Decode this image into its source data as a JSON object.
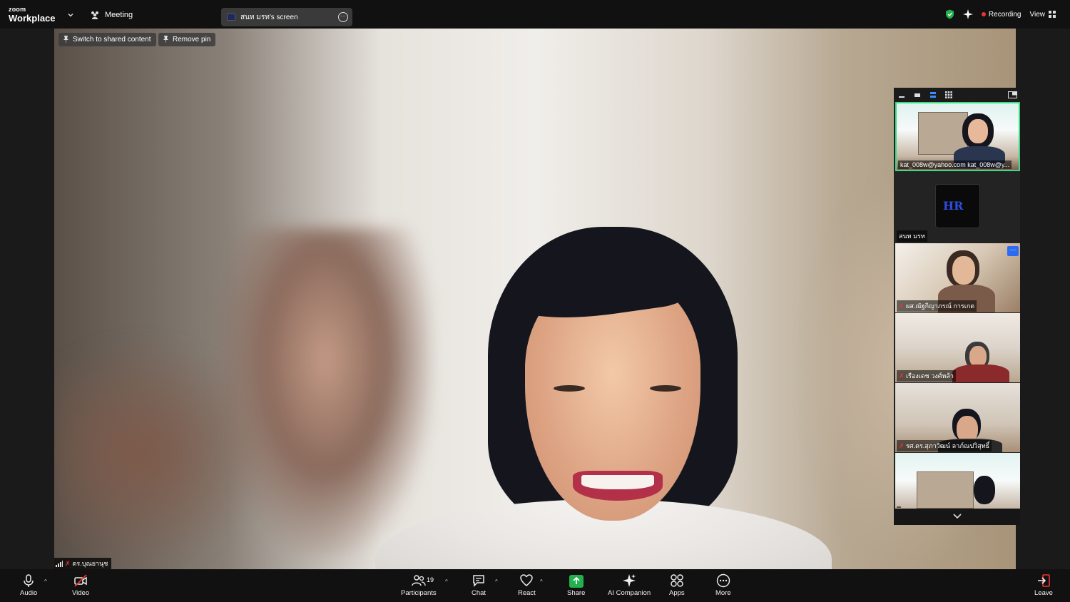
{
  "topbar": {
    "logo_small": "zoom",
    "logo_big": "Workplace",
    "meeting_label": "Meeting",
    "screen_share_label": "สนท มรท's screen",
    "recording_label": "Recording",
    "view_label": "View"
  },
  "main": {
    "pin_buttons": [
      "Switch to shared content",
      "Remove pin"
    ],
    "speaker_name": "ดร.บุณยานุช"
  },
  "gallery": {
    "tiles": [
      {
        "name": "kat_008w@yahoo.com kat_008w@y..."
      },
      {
        "name": "สนท มรท",
        "logo_text": "HR"
      },
      {
        "name": "ผส.ณัฐกิญาภรณ์ การเกต"
      },
      {
        "name": "เรืองเดช วงศ์หล้า"
      },
      {
        "name": "รศ.ดร.สุภาวัฒน์ ลาภ์ณปวิสุทธิ์"
      },
      {
        "name": ""
      }
    ]
  },
  "toolbar": {
    "audio": "Audio",
    "video": "Video",
    "participants": "Participants",
    "participants_count": "19",
    "chat": "Chat",
    "react": "React",
    "share": "Share",
    "ai_companion": "AI Companion",
    "apps": "Apps",
    "more": "More",
    "leave": "Leave"
  },
  "colors": {
    "accent_green": "#3ddc84",
    "recording_red": "#ee3333",
    "share_green": "#22b14c"
  }
}
